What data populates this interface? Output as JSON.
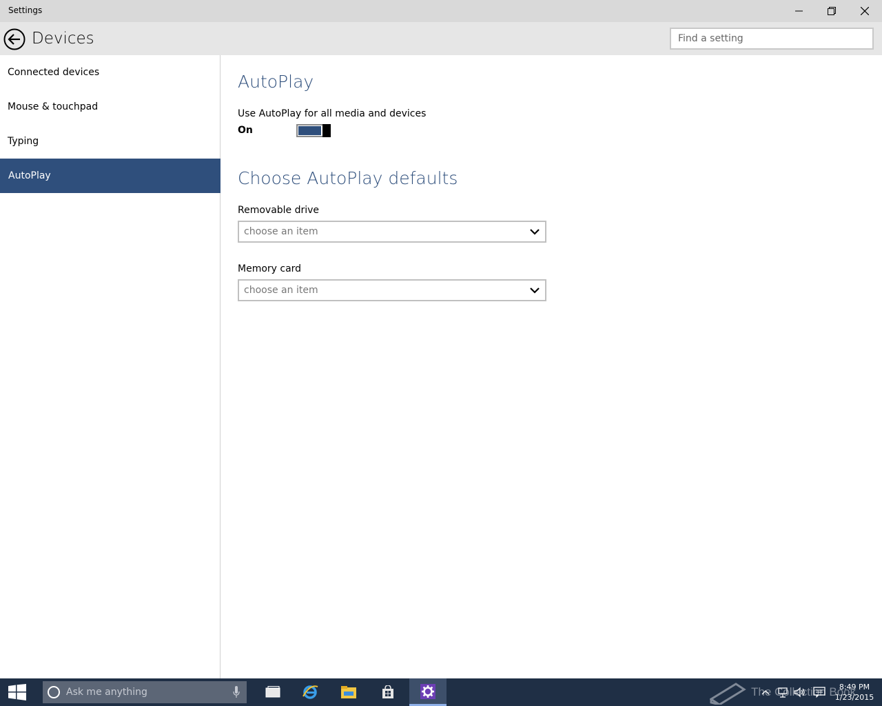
{
  "window": {
    "title": "Settings",
    "controls": [
      "minimize",
      "maximize",
      "close"
    ]
  },
  "header": {
    "page_title": "Devices",
    "search_placeholder": "Find a setting"
  },
  "sidebar": {
    "items": [
      {
        "label": "Connected devices",
        "active": false
      },
      {
        "label": "Mouse & touchpad",
        "active": false
      },
      {
        "label": "Typing",
        "active": false
      },
      {
        "label": "AutoPlay",
        "active": true
      }
    ]
  },
  "main": {
    "section_title": "AutoPlay",
    "autoplay_label": "Use AutoPlay for all media and devices",
    "toggle_state": "On",
    "toggle_on": true,
    "defaults_title": "Choose AutoPlay defaults",
    "removable_label": "Removable drive",
    "removable_value": "choose an item",
    "memory_label": "Memory card",
    "memory_value": "choose an item"
  },
  "taskbar": {
    "search_placeholder": "Ask me anything",
    "apps": [
      "task-view",
      "internet-explorer",
      "file-explorer",
      "store",
      "settings"
    ],
    "active_app": "settings",
    "watermark": "The Collection Book",
    "time": "8:49 PM",
    "date": "1/23/2015"
  },
  "colors": {
    "accent": "#2f4f7c",
    "taskbar": "#1f2f45",
    "titlebar": "#d9d9d9",
    "header": "#e6e6e6"
  }
}
